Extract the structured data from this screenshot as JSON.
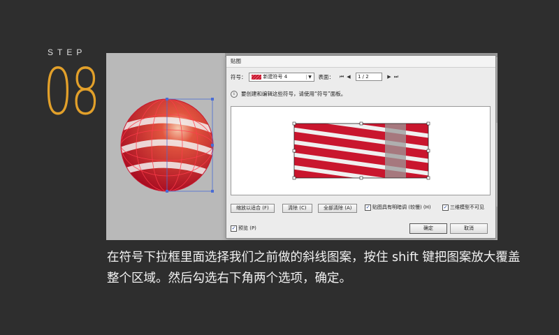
{
  "step": {
    "label": "STEP",
    "number": "08"
  },
  "dialog": {
    "title": "贴图",
    "symbol_label": "符号：",
    "symbol_value": "新建符号 4",
    "surface_label": "表面：",
    "surface_value": "1 / 2",
    "info_text": "要创建和编辑这些符号，请使用“符号”面板。",
    "buttons": {
      "fit": "缩放以适合 (F)",
      "clear": "清除 (C)",
      "clear_all": "全部清除 (A)",
      "ok": "确定",
      "cancel": "取消"
    },
    "checkboxes": {
      "shade_artwork": {
        "label": "贴图具有明暗调 (较慢) (H)",
        "checked": true
      },
      "invisible_geometry": {
        "label": "三维模型不可见",
        "checked": true
      },
      "preview": {
        "label": "预览 (P)",
        "checked": true
      }
    }
  },
  "caption": "在符号下拉框里面选择我们之前做的斜线图案，按住 shift 键把图案放大覆盖整个区域。然后勾选右下角两个选项，确定。",
  "colors": {
    "accent": "#e2a02a",
    "artwork_red": "#c9162e",
    "artwork_stripe": "#f0f0f0",
    "selection": "#4a6cd4"
  }
}
